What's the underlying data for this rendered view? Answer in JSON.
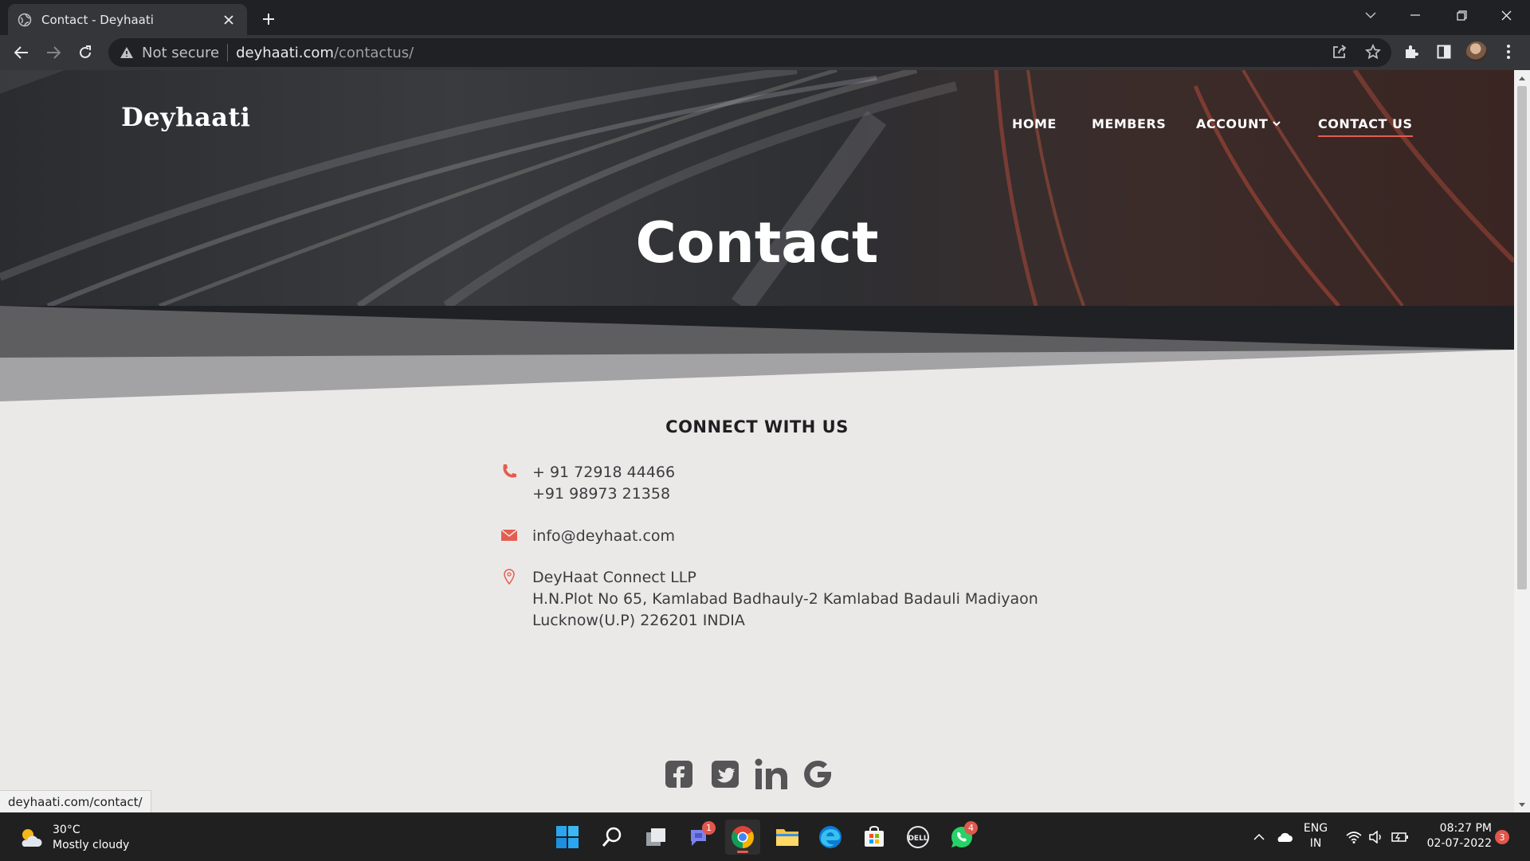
{
  "browser": {
    "tab_title": "Contact - Deyhaati",
    "security_label": "Not secure",
    "url_host": "deyhaati.com",
    "url_path": "/contactus/",
    "status_url": "deyhaati.com/contact/"
  },
  "site": {
    "logo": "Deyhaati",
    "nav": {
      "home": "HOME",
      "members": "MEMBERS",
      "account": "ACCOUNT",
      "contact": "CONTACT US"
    },
    "hero_title": "Contact",
    "section_title": "CONNECT WITH US",
    "phone_1": "+ 91 72918 44466",
    "phone_2": "+91 98973 21358",
    "email": "info@deyhaat.com",
    "address_1": "DeyHaat Connect LLP",
    "address_2": "H.N.Plot No 65, Kamlabad Badhauly-2 Kamlabad Badauli Madiyaon",
    "address_3": "Lucknow(U.P) 226201 INDIA",
    "accent_color": "#e35d50",
    "social_icons": [
      "facebook-icon",
      "twitter-icon",
      "linkedin-icon",
      "google-icon"
    ]
  },
  "taskbar": {
    "weather_temp": "30°C",
    "weather_desc": "Mostly cloudy",
    "teams_badge": "1",
    "whatsapp_badge": "4",
    "lang_1": "ENG",
    "lang_2": "IN",
    "time": "08:27 PM",
    "date": "02-07-2022",
    "notifications": "3"
  }
}
